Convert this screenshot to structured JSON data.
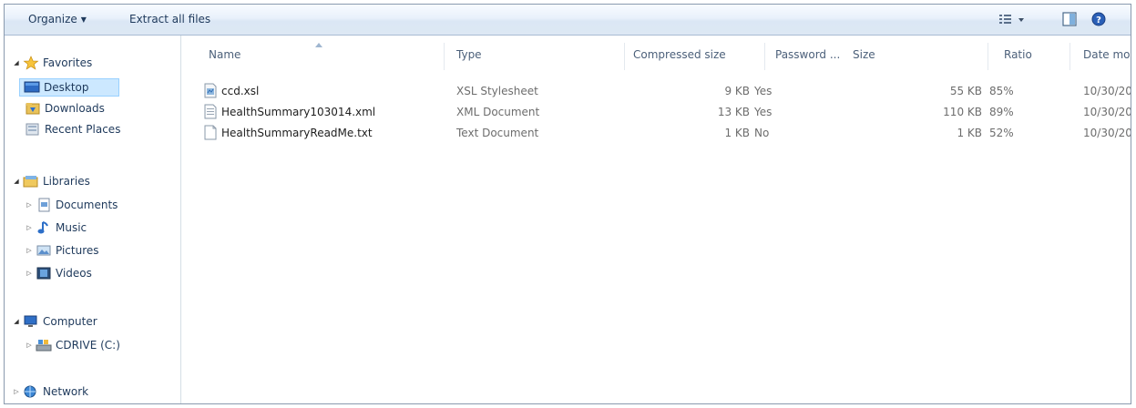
{
  "toolbar": {
    "organize_label": "Organize",
    "extract_label": "Extract all files"
  },
  "nav": {
    "favorites": {
      "label": "Favorites",
      "items": [
        "Desktop",
        "Downloads",
        "Recent Places"
      ]
    },
    "libraries": {
      "label": "Libraries",
      "items": [
        "Documents",
        "Music",
        "Pictures",
        "Videos"
      ]
    },
    "computer": {
      "label": "Computer",
      "items": [
        "CDRIVE (C:)"
      ]
    },
    "network": {
      "label": "Network"
    }
  },
  "columns": {
    "name": "Name",
    "type": "Type",
    "compressed": "Compressed size",
    "password": "Password ...",
    "size": "Size",
    "ratio": "Ratio",
    "date": "Date mo"
  },
  "files": [
    {
      "name": "ccd.xsl",
      "type": "XSL Stylesheet",
      "compressed": "9 KB",
      "password": "Yes",
      "size": "55 KB",
      "ratio": "85%",
      "date": "10/30/20",
      "icon": "xsl-file-icon"
    },
    {
      "name": "HealthSummary103014.xml",
      "type": "XML Document",
      "compressed": "13 KB",
      "password": "Yes",
      "size": "110 KB",
      "ratio": "89%",
      "date": "10/30/20",
      "icon": "xml-file-icon"
    },
    {
      "name": "HealthSummaryReadMe.txt",
      "type": "Text Document",
      "compressed": "1 KB",
      "password": "No",
      "size": "1 KB",
      "ratio": "52%",
      "date": "10/30/20",
      "icon": "txt-file-icon"
    }
  ]
}
